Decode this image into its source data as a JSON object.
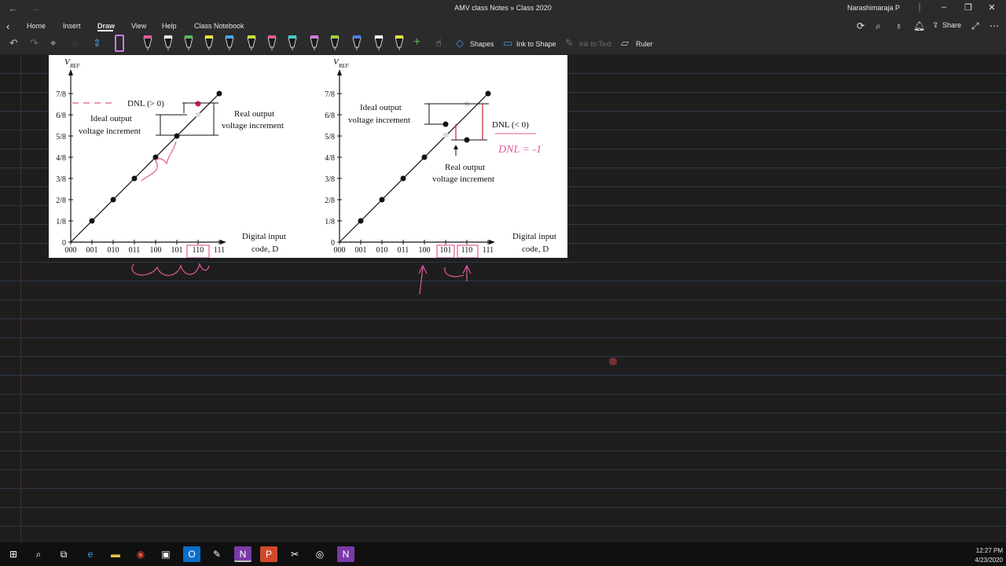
{
  "window": {
    "title": "AMV class Notes » Class 2020",
    "user": "Narashimaraja P"
  },
  "menu": {
    "tabs": [
      "Home",
      "Insert",
      "Draw",
      "View",
      "Help",
      "Class Notebook"
    ],
    "active_tab": "Draw",
    "share_label": "Share"
  },
  "toolbar": {
    "shapes_label": "Shapes",
    "ink_to_shape_label": "Ink to Shape",
    "ink_to_text_label": "Ink to Text",
    "ruler_label": "Ruler",
    "pen_colors": [
      "#e05a9a",
      "#e8e8e8",
      "#5ab85a",
      "#e8e040",
      "#4aa8e8",
      "#c0e040",
      "#e05a9a",
      "#40d0d0",
      "#d07ae8",
      "#a0d040",
      "#4a80e8",
      "#ffffff",
      "#e8e040"
    ]
  },
  "figure": {
    "left_chart": {
      "y_axis_label": "V",
      "y_axis_sub": "REF",
      "y_ticks": [
        "0",
        "1/8",
        "2/8",
        "3/8",
        "4/8",
        "5/8",
        "6/8",
        "7/8"
      ],
      "x_ticks": [
        "000",
        "001",
        "010",
        "011",
        "100",
        "101",
        "110",
        "111"
      ],
      "x_axis_label_1": "Digital input",
      "x_axis_label_2": "code, D",
      "dnl_label": "DNL (> 0)",
      "ideal_label_1": "Ideal output",
      "ideal_label_2": "voltage increment",
      "real_label_1": "Real output",
      "real_label_2": "voltage increment"
    },
    "right_chart": {
      "y_axis_label": "V",
      "y_axis_sub": "REF",
      "y_ticks": [
        "0",
        "1/8",
        "2/8",
        "3/8",
        "4/8",
        "5/8",
        "6/8",
        "7/8"
      ],
      "x_ticks": [
        "000",
        "001",
        "010",
        "011",
        "100",
        "101",
        "110",
        "111"
      ],
      "x_axis_label_1": "Digital input",
      "x_axis_label_2": "code, D",
      "dnl_label": "DNL (< 0)",
      "ideal_label_1": "Ideal output",
      "ideal_label_2": "voltage increment",
      "real_label_1": "Real output",
      "real_label_2": "voltage increment",
      "handwritten_note": "DNL = -1"
    }
  },
  "taskbar": {
    "time": "12:27 PM",
    "date": "4/23/2020"
  }
}
